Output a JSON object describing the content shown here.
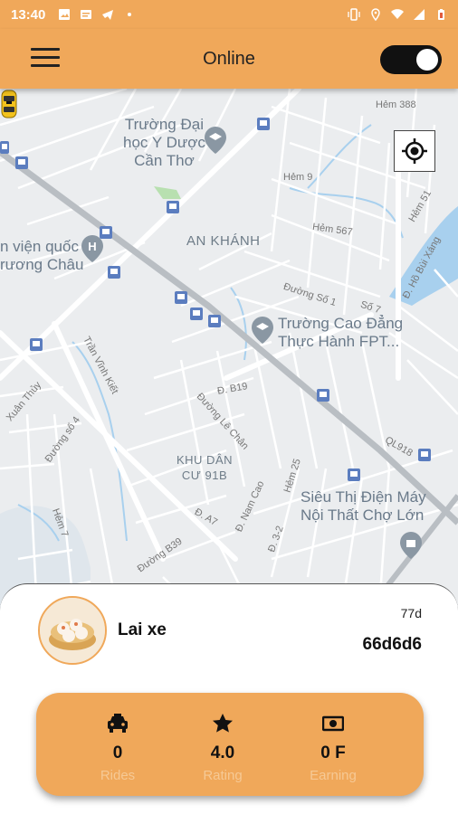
{
  "status_bar": {
    "time": "13:40"
  },
  "app_bar": {
    "title": "Online",
    "online_toggle": true
  },
  "map": {
    "labels": {
      "hospital_line1": "Trường Đại",
      "hospital_line2": "học Y Dược",
      "hospital_line3": "Cần Thơ",
      "hem388": "Hẻm 388",
      "hem9": "Hẻm 9",
      "hem567": "Hẻm 567",
      "hem51": "Hẻm 51",
      "an_khanh": "AN KHÁNH",
      "vien_line1": "n viện quốc",
      "vien_line2": "rương Châu",
      "duong_so1": "Đường Số 1",
      "so7": "Số 7",
      "college_line1": "Trường Cao Đẳng",
      "college_line2": "Thực Hành FPT...",
      "hb_bui_xang": "Đ. Hồ Bùi Xáng",
      "tran_vinh_kiet": "Trần Vĩnh Kiết",
      "xuan_thuy": "Xuân Thủy",
      "d_b19": "Đ. B19",
      "duong_le_chan": "Đường Lê Chân",
      "duong_so4": "Đường số 4",
      "ql918": "QL918",
      "khu_dan_cu_line1": "KHU DÂN",
      "khu_dan_cu_line2": "CƯ 91B",
      "hem25": "Hẻm 25",
      "sieu_thi_line1": "Siêu Thị Điện Máy",
      "sieu_thi_line2": "Nội Thất Chợ Lớn",
      "nam_cao": "Đ. Nam Cao",
      "hem7": "Hẻm 7",
      "d_a7": "Đ. A7",
      "d_3_2": "Đ. 3-2",
      "duong_b39": "Đường B39"
    }
  },
  "driver": {
    "name": "Lai xe",
    "code_small": "77d",
    "code_big": "66d6d6"
  },
  "stats": [
    {
      "icon": "car-icon",
      "value": "0",
      "label": "Rides"
    },
    {
      "icon": "star-icon",
      "value": "4.0",
      "label": "Rating"
    },
    {
      "icon": "money-icon",
      "value": "0 F",
      "label": "Earning"
    }
  ],
  "colors": {
    "accent": "#f0a85a",
    "stat_label": "#f6c995"
  }
}
